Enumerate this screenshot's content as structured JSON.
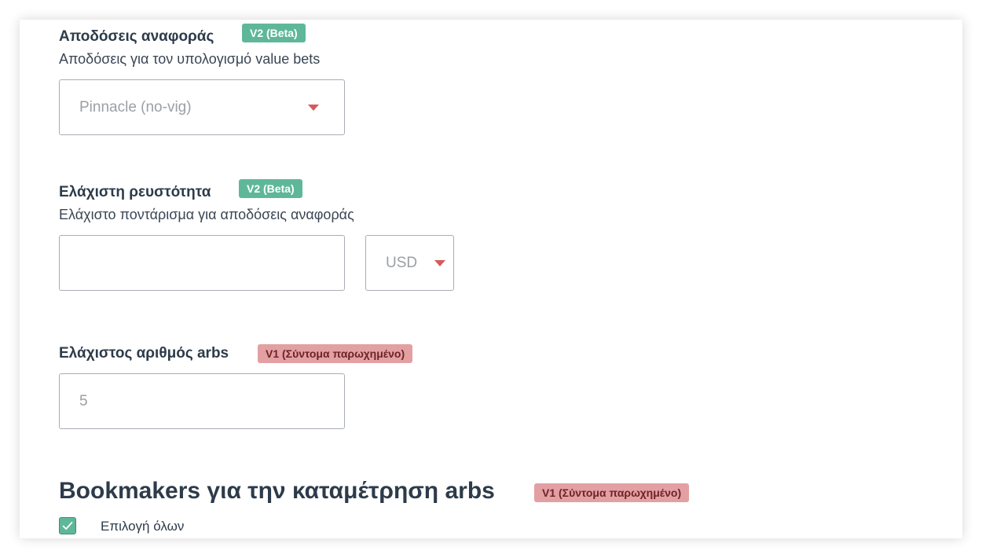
{
  "reference_odds": {
    "title": "Αποδόσεις αναφοράς",
    "badge": "V2 (Beta)",
    "description": "Αποδόσεις για τον υπολογισμό value bets",
    "select_value": "Pinnacle (no-vig)"
  },
  "min_liquidity": {
    "title": "Ελάχιστη ρευστότητα",
    "badge": "V2 (Beta)",
    "description": "Ελάχιστο ποντάρισμα για αποδόσεις αναφοράς",
    "amount_value": "",
    "currency_value": "USD"
  },
  "min_arbs": {
    "title": "Ελάχιστος αριθμός arbs",
    "badge": "V1 (Σύντομα παρωχημένο)",
    "value": "5"
  },
  "bookmakers": {
    "title": "Bookmakers για την καταμέτρηση arbs",
    "badge": "V1 (Σύντομα παρωχημένο)",
    "select_all_label": "Επιλογή όλων",
    "select_all_checked": true
  },
  "colors": {
    "badge_v2": "#5fb79a",
    "badge_v1": "#e3a0a2",
    "caret": "#d25c5c",
    "text": "#2d3b4a"
  }
}
